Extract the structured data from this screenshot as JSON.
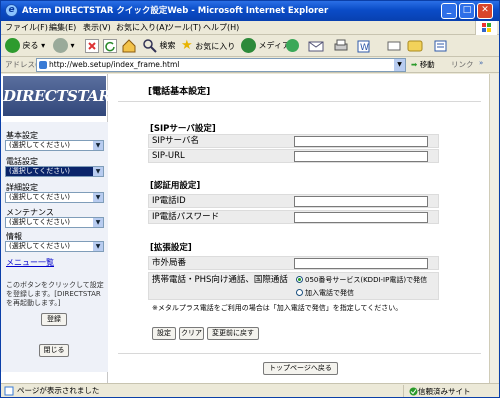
{
  "window": {
    "title": "Aterm DIRECTSTAR クイック設定Web - Microsoft Internet Explorer"
  },
  "menu": [
    "ファイル(F)",
    "編集(E)",
    "表示(V)",
    "お気に入り(A)",
    "ツール(T)",
    "ヘルプ(H)"
  ],
  "toolbar": {
    "back": "戻る",
    "search": "検索",
    "favorites": "お気に入り",
    "media": "メディア"
  },
  "address": {
    "label": "アドレス(D)",
    "url": "http://web.setup/index_frame.html",
    "go": "移動",
    "links": "リンク"
  },
  "sidebar": {
    "logo": "DIRECTSTAR",
    "groups": [
      {
        "label": "基本設定",
        "value": "(選択してください)"
      },
      {
        "label": "電話設定",
        "value": "(選択してください)"
      },
      {
        "label": "詳細設定",
        "value": "(選択してください)"
      },
      {
        "label": "メンテナンス",
        "value": "(選択してください)"
      },
      {
        "label": "情報",
        "value": "(選択してください)"
      }
    ],
    "menu_list": "メニュー一覧",
    "note": "このボタンをクリックして設定を登録します。[DIRECTSTARを再起動します。]",
    "register_button": "登録",
    "close_button": "閉じる"
  },
  "main": {
    "title": "[電話基本設定]",
    "sip_section": "[SIPサーバ設定]",
    "sip_server_label": "SIPサーバ名",
    "sip_url_label": "SIP-URL",
    "auth_section": "[認証用設定]",
    "phone_id_label": "IP電話ID",
    "phone_pw_label": "IP電話パスワード",
    "ext_section": "[拡張設定]",
    "area_code_label": "市外局番",
    "mobile_label": "携帯電話・PHS向け通話、国際通話",
    "radio1": "050番号サービス(KDDI-IP電話)で発信",
    "radio2": "加入電話で発信",
    "note": "※メタルプラス電話をご利用の場合は「加入電話で発信」を指定してください。",
    "btn_set": "設定",
    "btn_clear": "クリア",
    "btn_revert": "変更前に戻す",
    "btn_top": "トップページへ戻る"
  },
  "status": {
    "left": "ページが表示されました",
    "right": "信頼済みサイト"
  }
}
